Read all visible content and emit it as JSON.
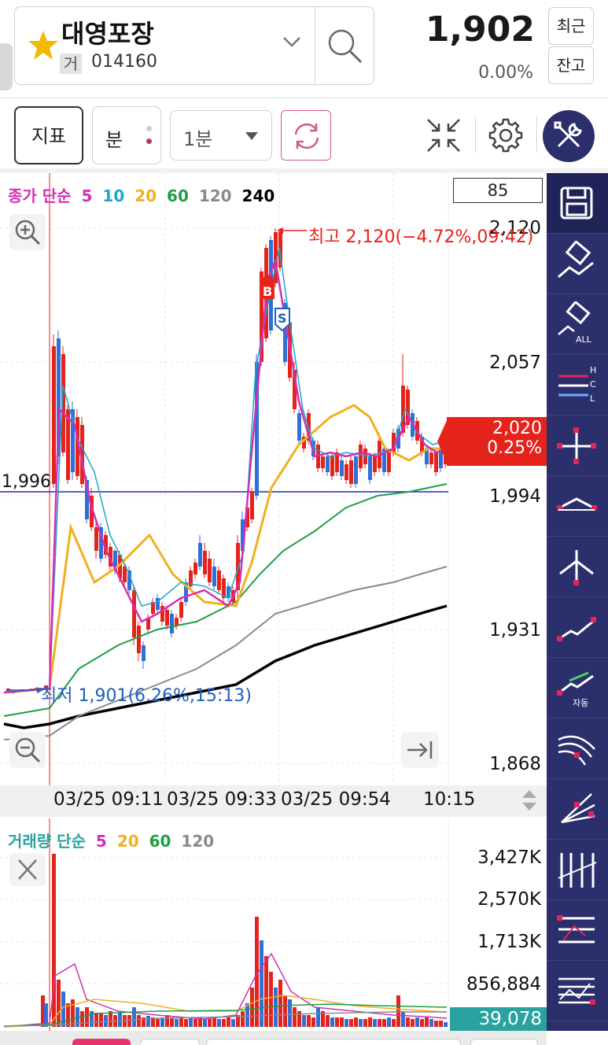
{
  "header": {
    "stock_name": "대영포장",
    "market_badge": "거",
    "stock_code": "014160",
    "price": "1,902",
    "change_rate": "0.00%",
    "recent_button": "최근",
    "balance_button": "잔고"
  },
  "toolbar": {
    "indicator_button": "지표",
    "unit_button": "분",
    "period_select": "1분"
  },
  "chart": {
    "legend_title": "종가 단순",
    "ma_periods": [
      "5",
      "10",
      "20",
      "60",
      "120",
      "240"
    ],
    "ma_colors": [
      "#d42fb4",
      "#1aa7c9",
      "#f0b020",
      "#1e9e44",
      "#8a8a8a",
      "#000000"
    ],
    "count_box": "85",
    "price_ticks": [
      "2,120",
      "2,057",
      "1,994",
      "1,931",
      "1,868"
    ],
    "left_line_label": "1,996",
    "high_annotation": "최고 2,120(−4.72%,09:42)",
    "low_annotation": "최저 1,901(6.26%,15:13)",
    "current_price_tag": "2,020",
    "current_rate_tag": "0.25%",
    "buy_marker": "B",
    "sell_marker": "S",
    "x_labels": [
      "03/25 09:11",
      "03/25 09:33",
      "03/25 09:54",
      "10:15"
    ]
  },
  "volume": {
    "legend_title": "거래량 단순",
    "ma_periods": [
      "5",
      "20",
      "60",
      "120"
    ],
    "ma_colors": [
      "#d42fb4",
      "#f0b020",
      "#1e9e44",
      "#8a8a8a"
    ],
    "ticks": [
      "3,427K",
      "2,570K",
      "1,713K",
      "856,884"
    ],
    "current_volume": "39,078"
  },
  "right_toolbar": {
    "icons": [
      "save-icon",
      "eraser-icon",
      "eraser-all-icon",
      "hlc-lines-icon",
      "crosshair-icon",
      "point-line-icon",
      "vertical-line-icon",
      "trend-line-icon",
      "auto-trend-icon",
      "fan-arc-icon",
      "fan-lines-icon",
      "vertical-bars-icon",
      "channel-icon",
      "fibonacci-icon"
    ],
    "all_label": "ALL",
    "auto_label": "자동",
    "hcl_labels": [
      "H",
      "C",
      "L"
    ]
  },
  "colors": {
    "up": "#e5231b",
    "down": "#2f6fd8",
    "accent_blue": "#1f5fbf",
    "toolbar_bg": "#2b2f6b"
  }
}
